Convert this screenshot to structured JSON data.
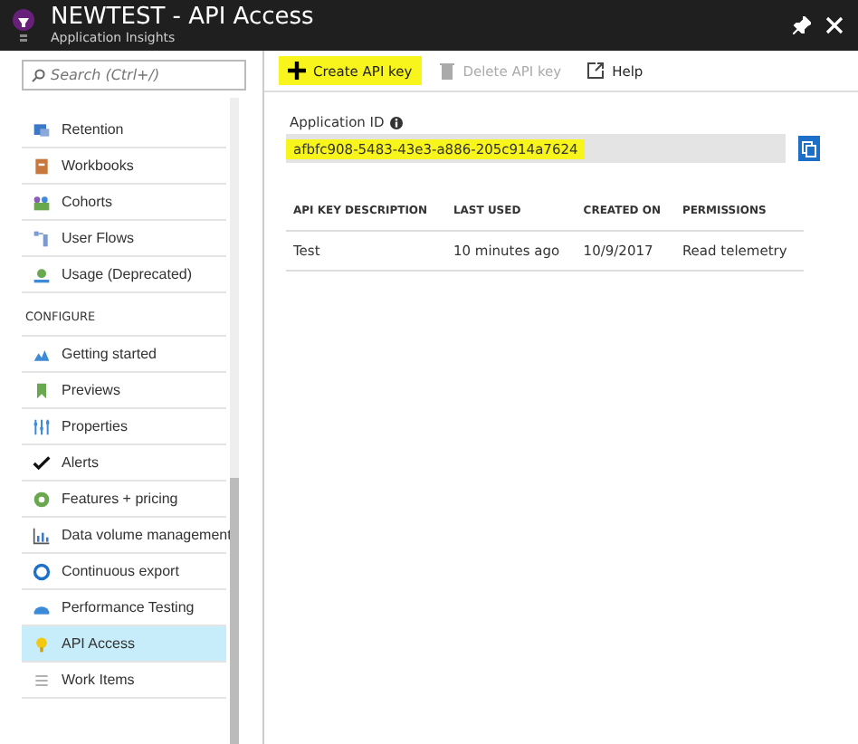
{
  "window": {
    "title": "NEWTEST - API Access",
    "subtitle": "Application Insights"
  },
  "sidebar": {
    "search": {
      "placeholder": "Search (Ctrl+/)"
    },
    "sections": [
      {
        "items": [
          {
            "label": "Retention",
            "selected": false
          },
          {
            "label": "Workbooks",
            "selected": false
          },
          {
            "label": "Cohorts",
            "selected": false
          },
          {
            "label": "User Flows",
            "selected": false
          },
          {
            "label": "Usage (Deprecated)",
            "selected": false
          }
        ]
      },
      {
        "heading": "CONFIGURE",
        "items": [
          {
            "label": "Getting started",
            "selected": false
          },
          {
            "label": "Previews",
            "selected": false
          },
          {
            "label": "Properties",
            "selected": false
          },
          {
            "label": "Alerts",
            "selected": false
          },
          {
            "label": "Features + pricing",
            "selected": false
          },
          {
            "label": "Data volume management",
            "selected": false
          },
          {
            "label": "Continuous export",
            "selected": false
          },
          {
            "label": "Performance Testing",
            "selected": false
          },
          {
            "label": "API Access",
            "selected": true
          },
          {
            "label": "Work Items",
            "selected": false
          }
        ]
      }
    ]
  },
  "toolbar": [
    {
      "label": "Create API key",
      "disabled": false,
      "highlighted": true
    },
    {
      "label": "Delete API key",
      "disabled": true,
      "highlighted": false
    },
    {
      "label": "Help",
      "disabled": false,
      "highlighted": false
    }
  ],
  "application_id": {
    "label": "Application ID",
    "value": "afbfc908-5483-43e3-a886-205c914a7624",
    "highlighted": true
  },
  "table": {
    "columns": [
      "API KEY DESCRIPTION",
      "LAST USED",
      "CREATED ON",
      "PERMISSIONS"
    ],
    "rows": [
      [
        "Test",
        "10 minutes ago",
        "10/9/2017",
        "Read telemetry"
      ]
    ]
  }
}
